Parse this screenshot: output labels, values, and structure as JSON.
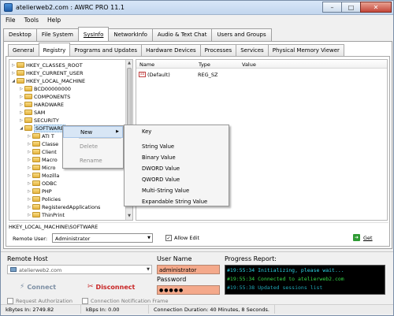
{
  "window": {
    "title": "atelierweb2.com : AWRC PRO 11.1",
    "controls": {
      "minimize": "–",
      "maximize": "□",
      "close": "✕"
    }
  },
  "menubar": [
    "File",
    "Tools",
    "Help"
  ],
  "main_tabs": [
    {
      "label": "Desktop",
      "active": false
    },
    {
      "label": "File System",
      "active": false
    },
    {
      "label": "SysInfo",
      "active": true
    },
    {
      "label": "NetworkInfo",
      "active": false
    },
    {
      "label": "Audio & Text Chat",
      "active": false
    },
    {
      "label": "Users and Groups",
      "active": false
    }
  ],
  "sub_tabs": [
    {
      "label": "General",
      "active": false
    },
    {
      "label": "Registry",
      "active": true
    },
    {
      "label": "Programs and Updates",
      "active": false
    },
    {
      "label": "Hardware Devices",
      "active": false
    },
    {
      "label": "Processes",
      "active": false
    },
    {
      "label": "Services",
      "active": false
    },
    {
      "label": "Physical Memory Viewer",
      "active": false
    }
  ],
  "tree": [
    {
      "label": "HKEY_CLASSES_ROOT",
      "indent": 0,
      "expander": "collapsed"
    },
    {
      "label": "HKEY_CURRENT_USER",
      "indent": 0,
      "expander": "collapsed"
    },
    {
      "label": "HKEY_LOCAL_MACHINE",
      "indent": 0,
      "expander": "expanded"
    },
    {
      "label": "BCD00000000",
      "indent": 1,
      "expander": "collapsed"
    },
    {
      "label": "COMPONENTS",
      "indent": 1,
      "expander": "collapsed"
    },
    {
      "label": "HARDWARE",
      "indent": 1,
      "expander": "collapsed"
    },
    {
      "label": "SAM",
      "indent": 1,
      "expander": "collapsed"
    },
    {
      "label": "SECURITY",
      "indent": 1,
      "expander": "collapsed"
    },
    {
      "label": "SOFTWARE",
      "indent": 1,
      "expander": "expanded",
      "selected": true
    },
    {
      "label": "ATI T",
      "indent": 2,
      "expander": "collapsed"
    },
    {
      "label": "Classe",
      "indent": 2,
      "expander": "collapsed"
    },
    {
      "label": "Client",
      "indent": 2,
      "expander": "collapsed"
    },
    {
      "label": "Macro",
      "indent": 2,
      "expander": "collapsed"
    },
    {
      "label": "Micro",
      "indent": 2,
      "expander": "collapsed"
    },
    {
      "label": "Mozilla",
      "indent": 2,
      "expander": "collapsed"
    },
    {
      "label": "ODBC",
      "indent": 2,
      "expander": "collapsed"
    },
    {
      "label": "PHP",
      "indent": 2,
      "expander": "collapsed"
    },
    {
      "label": "Policies",
      "indent": 2,
      "expander": "collapsed"
    },
    {
      "label": "RegisteredApplications",
      "indent": 2,
      "expander": "collapsed"
    },
    {
      "label": "ThinPrint",
      "indent": 2,
      "expander": "collapsed"
    }
  ],
  "values_table": {
    "headers": {
      "name": "Name",
      "type": "Type",
      "value": "Value"
    },
    "rows": [
      {
        "icon": "ab",
        "name": "(Default)",
        "type": "REG_SZ",
        "value": ""
      }
    ]
  },
  "path": "HKEY_LOCAL_MACHINE\\SOFTWARE",
  "remote_user": {
    "label": "Remote User:",
    "value": "Administrator"
  },
  "allow_edit": {
    "label": "Allow Edit",
    "checked": true
  },
  "get_button": {
    "label": "Get"
  },
  "context_menu": {
    "items": [
      {
        "label": "New",
        "highlighted": true,
        "disabled": false,
        "has_submenu": true
      },
      {
        "label": "Delete",
        "highlighted": false,
        "disabled": true,
        "has_submenu": false
      },
      {
        "label": "Rename",
        "highlighted": false,
        "disabled": true,
        "has_submenu": false
      }
    ],
    "submenu": [
      "Key",
      "String Value",
      "Binary Value",
      "DWORD Value",
      "QWORD Value",
      "Multi-String Value",
      "Expandable String Value"
    ]
  },
  "remote_host": {
    "label": "Remote Host",
    "value": "atelierweb2.com",
    "connect_label": "Connect",
    "disconnect_label": "Disconnect"
  },
  "credentials": {
    "username_label": "User Name",
    "username": "administrator",
    "password_label": "Password",
    "password_mask": "●●●●●"
  },
  "progress": {
    "label": "Progress Report:",
    "lines": [
      "#19:55:34 Initializing, please wait...",
      "#19:55:34 Connected to atelierweb2.com",
      "#19:55:38 Updated sessions list"
    ]
  },
  "options": [
    {
      "label": "Request Authorization",
      "checked": false
    },
    {
      "label": "Connection Notification Frame",
      "checked": false
    }
  ],
  "statusbar": {
    "kbytes_in": "kBytes In: 2749.82",
    "kbps_in": "kBps In: 0.00",
    "duration": "Connection Duration: 40 Minutes, 8 Seconds."
  },
  "colors": {
    "accent": "#2f9b34",
    "disconnect": "#c82424",
    "credential_bg": "#f4a98b",
    "console_bg": "#000000"
  }
}
